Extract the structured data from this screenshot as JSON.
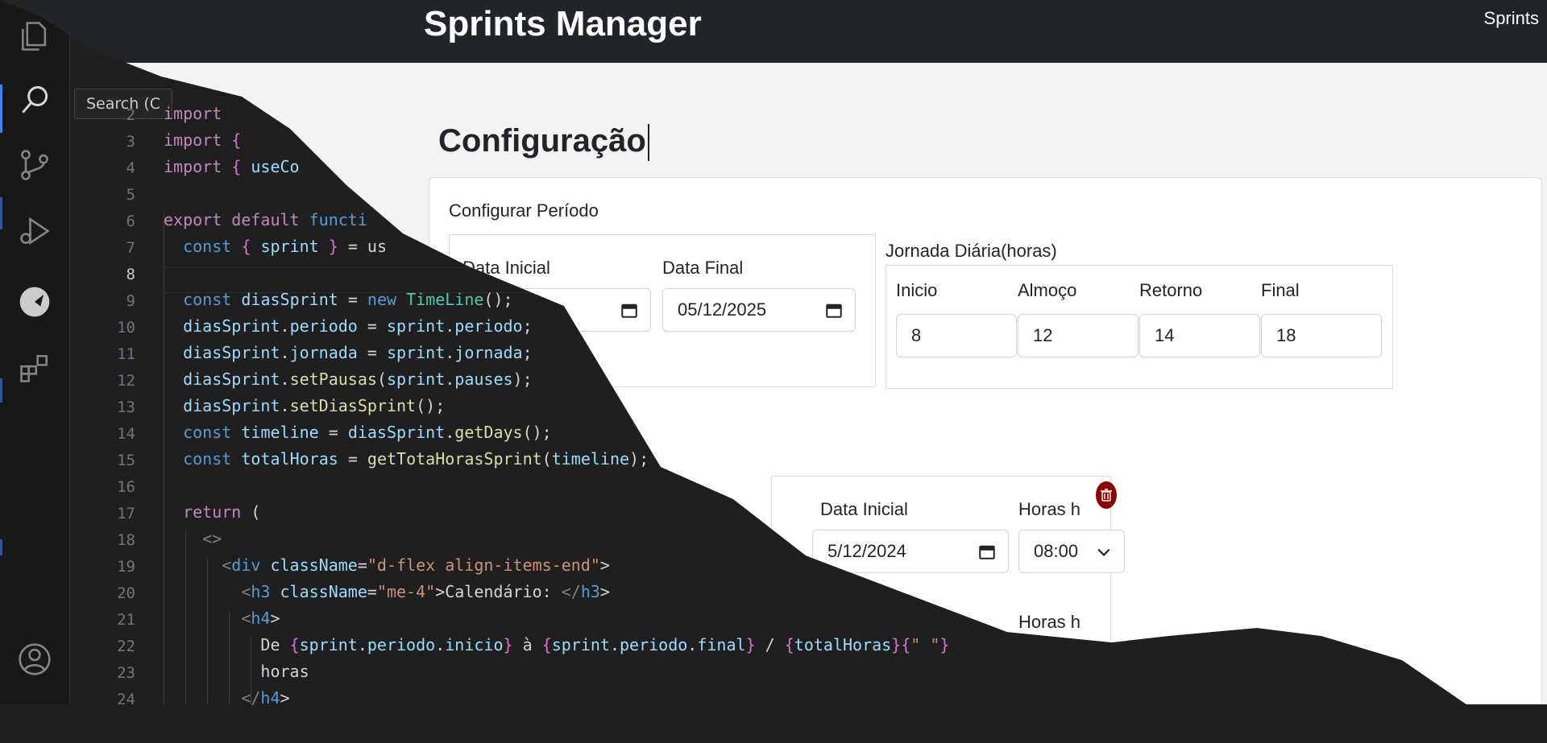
{
  "vscode": {
    "tooltip": "Search (C",
    "lines": [
      {
        "n": "2",
        "code": "import"
      },
      {
        "n": "3",
        "code": "import {"
      },
      {
        "n": "4",
        "code": "import { useCo"
      },
      {
        "n": "5",
        "code": ""
      },
      {
        "n": "6",
        "code": "export default functi"
      },
      {
        "n": "7",
        "code": "  const { sprint } = us"
      },
      {
        "n": "8",
        "code": ""
      },
      {
        "n": "9",
        "code": "  const diasSprint = new TimeLine();"
      },
      {
        "n": "10",
        "code": "  diasSprint.periodo = sprint.periodo;"
      },
      {
        "n": "11",
        "code": "  diasSprint.jornada = sprint.jornada;"
      },
      {
        "n": "12",
        "code": "  diasSprint.setPausas(sprint.pauses);"
      },
      {
        "n": "13",
        "code": "  diasSprint.setDiasSprint();"
      },
      {
        "n": "14",
        "code": "  const timeline = diasSprint.getDays();"
      },
      {
        "n": "15",
        "code": "  const totalHoras = getTotaHorasSprint(timeline);"
      },
      {
        "n": "16",
        "code": ""
      },
      {
        "n": "17",
        "code": "  return ("
      },
      {
        "n": "18",
        "code": "    <>"
      },
      {
        "n": "19",
        "code": "      <div className=\"d-flex align-items-end\">"
      },
      {
        "n": "20",
        "code": "        <h3 className=\"me-4\">Calendário: </h3>"
      },
      {
        "n": "21",
        "code": "        <h4>"
      },
      {
        "n": "22",
        "code": "          De {sprint.periodo.inicio} à {sprint.periodo.final} / {totalHoras}{\" \"}"
      },
      {
        "n": "23",
        "code": "          horas"
      },
      {
        "n": "24",
        "code": "        </h4>"
      }
    ]
  },
  "browser": {
    "app_title": "Sprints Manager",
    "nav_link": "Sprints",
    "page_heading": "Configuração",
    "card_title": "Configurar Período",
    "periodo": {
      "data_inicial_label": "Data Inicial",
      "data_final_label": "Data Final",
      "data_final_value": "05/12/2025"
    },
    "jornada": {
      "title": "Jornada Diária(horas)",
      "inicio_label": "Inicio",
      "inicio_value": "8",
      "almoco_label": "Almoço",
      "almoco_value": "12",
      "retorno_label": "Retorno",
      "retorno_value": "14",
      "final_label": "Final",
      "final_value": "18"
    },
    "pausa": {
      "data_inicial_label": "Data Inicial",
      "data_inicial_value": "5/12/2024",
      "horas_label": "Horas h",
      "horas_value": "08:00",
      "horas_label_2": "Horas h"
    },
    "colors": {
      "navbar": "#212529",
      "delete": "#8b0000"
    }
  }
}
